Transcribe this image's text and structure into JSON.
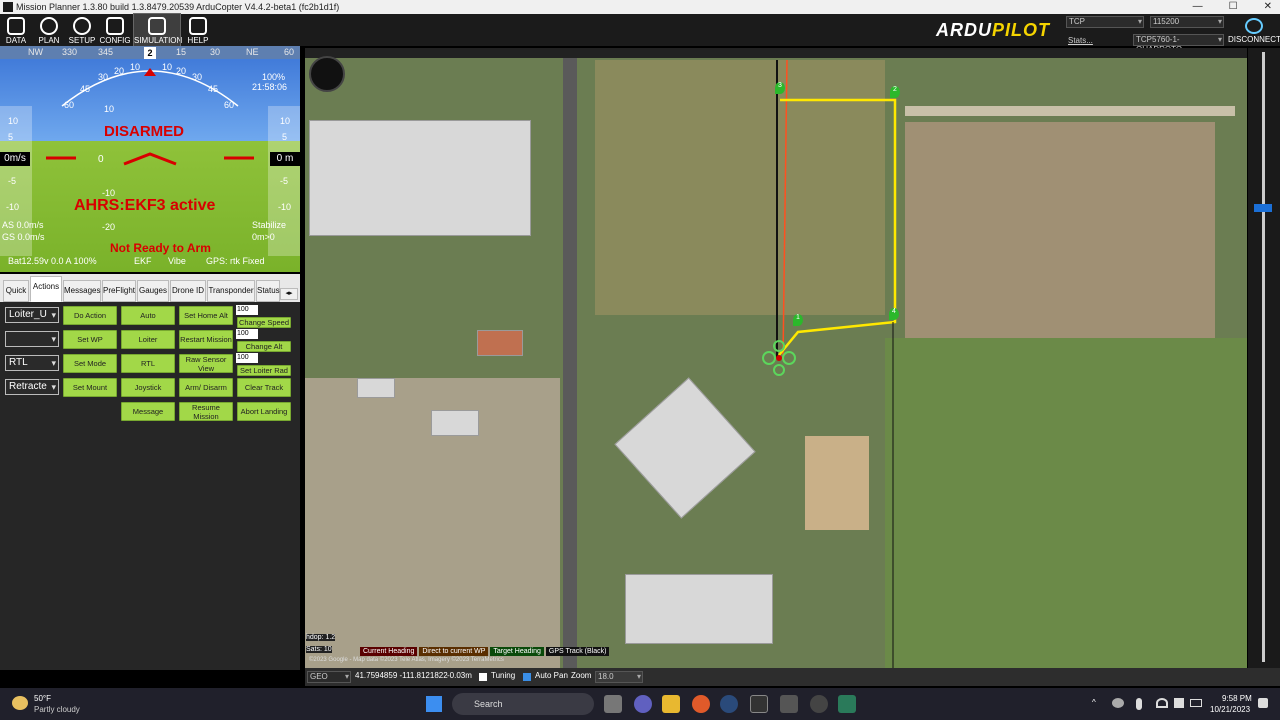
{
  "window": {
    "title": "Mission Planner 1.3.80 build 1.3.8479.20539 ArduCopter V4.4.2-beta1 (fc2b1d1f)",
    "controls": [
      "—",
      "☐",
      "✕"
    ]
  },
  "toolbar": {
    "items": [
      {
        "label": "DATA",
        "icon": "data-icon"
      },
      {
        "label": "PLAN",
        "icon": "plan-icon"
      },
      {
        "label": "SETUP",
        "icon": "setup-icon"
      },
      {
        "label": "CONFIG",
        "icon": "config-icon"
      },
      {
        "label": "SIMULATION",
        "icon": "simulation-icon"
      },
      {
        "label": "HELP",
        "icon": "help-icon"
      }
    ],
    "logo": {
      "part1": "ARDU",
      "part2": "PILOT"
    },
    "connection_type": "TCP",
    "baud": "115200",
    "stats_link": "Stats...",
    "port": "TCP5760-1-QUADROTO",
    "disconnect_label": "DISCONNECT"
  },
  "hud": {
    "compass": [
      "NW",
      "330",
      "345",
      "2",
      "15",
      "30",
      "NE",
      "60"
    ],
    "heading": "2",
    "status": "DISARMED",
    "ahrs": "AHRS:EKF3 active",
    "not_ready": "Not Ready to Arm",
    "speed_value": "0m/s",
    "alt_value": "0 m",
    "pitch_center": "0",
    "airspeed": "AS 0.0m/s",
    "groundspeed": "GS 0.0m/s",
    "mode": "Stabilize",
    "mode_sub": "0m>0",
    "battery_line": "Bat12.59v 0.0 A 100%",
    "ekf": "EKF",
    "vibe": "Vibe",
    "gps": "GPS: rtk Fixed",
    "link_quality": "100%",
    "clock": "21:58:06",
    "speed_ticks": [
      "10",
      "5",
      "-5",
      "-10"
    ],
    "alt_ticks": [
      "10",
      "5",
      "-5",
      "-10"
    ],
    "pitch_ticks": [
      "10",
      "-10",
      "-20"
    ],
    "roll_ticks": [
      "60",
      "45",
      "30",
      "20",
      "10",
      "10",
      "20",
      "30",
      "45",
      "60"
    ]
  },
  "tabs": [
    {
      "label": "Quick"
    },
    {
      "label": "Actions"
    },
    {
      "label": "Messages"
    },
    {
      "label": "PreFlight"
    },
    {
      "label": "Gauges"
    },
    {
      "label": "Drone ID"
    },
    {
      "label": "Transponder"
    },
    {
      "label": "Status"
    }
  ],
  "actions": {
    "selects": [
      "Loiter_U",
      "",
      "RTL",
      "Retracte"
    ],
    "col1": [
      "Do Action",
      "Set WP",
      "Set Mode",
      "Set Mount",
      "Message"
    ],
    "col2": [
      "Auto",
      "Loiter",
      "RTL",
      "Joystick",
      "Resume Mission"
    ],
    "col3": [
      "Set Home Alt",
      "Restart Mission",
      "Raw Sensor View",
      "Arm/ Disarm",
      "Abort Landing"
    ],
    "col4": [
      "Change Speed",
      "Change Alt",
      "Set Loiter Rad",
      "Clear Track"
    ],
    "num_value": "100"
  },
  "map": {
    "waypoints": [
      "3",
      "2",
      "1",
      "4"
    ],
    "hdop": "hdop: 1.2",
    "sats": "Sats: 10",
    "legend": [
      {
        "label": "Current Heading",
        "color": "#d00000"
      },
      {
        "label": "Direct to current WP",
        "color": "#e07800"
      },
      {
        "label": "Target Heading",
        "color": "#10a010"
      },
      {
        "label": "GPS Track (Black)",
        "color": "#ffffff"
      }
    ],
    "copyright": "©2023 Google - Map data ©2023 Tele Atlas, Imagery ©2023 TerraMetrics"
  },
  "bottombar": {
    "coord_type": "GEO",
    "coords": "41.7594859 -111.8121822",
    "alt": "-0.03m",
    "tuning_label": "Tuning",
    "autopan_label": "Auto Pan",
    "zoom_label": "Zoom",
    "zoom_value": "18.0"
  },
  "taskbar": {
    "weather_temp": "50°F",
    "weather_desc": "Partly cloudy",
    "search_placeholder": "Search",
    "time": "9:58 PM",
    "date": "10/21/2023"
  }
}
